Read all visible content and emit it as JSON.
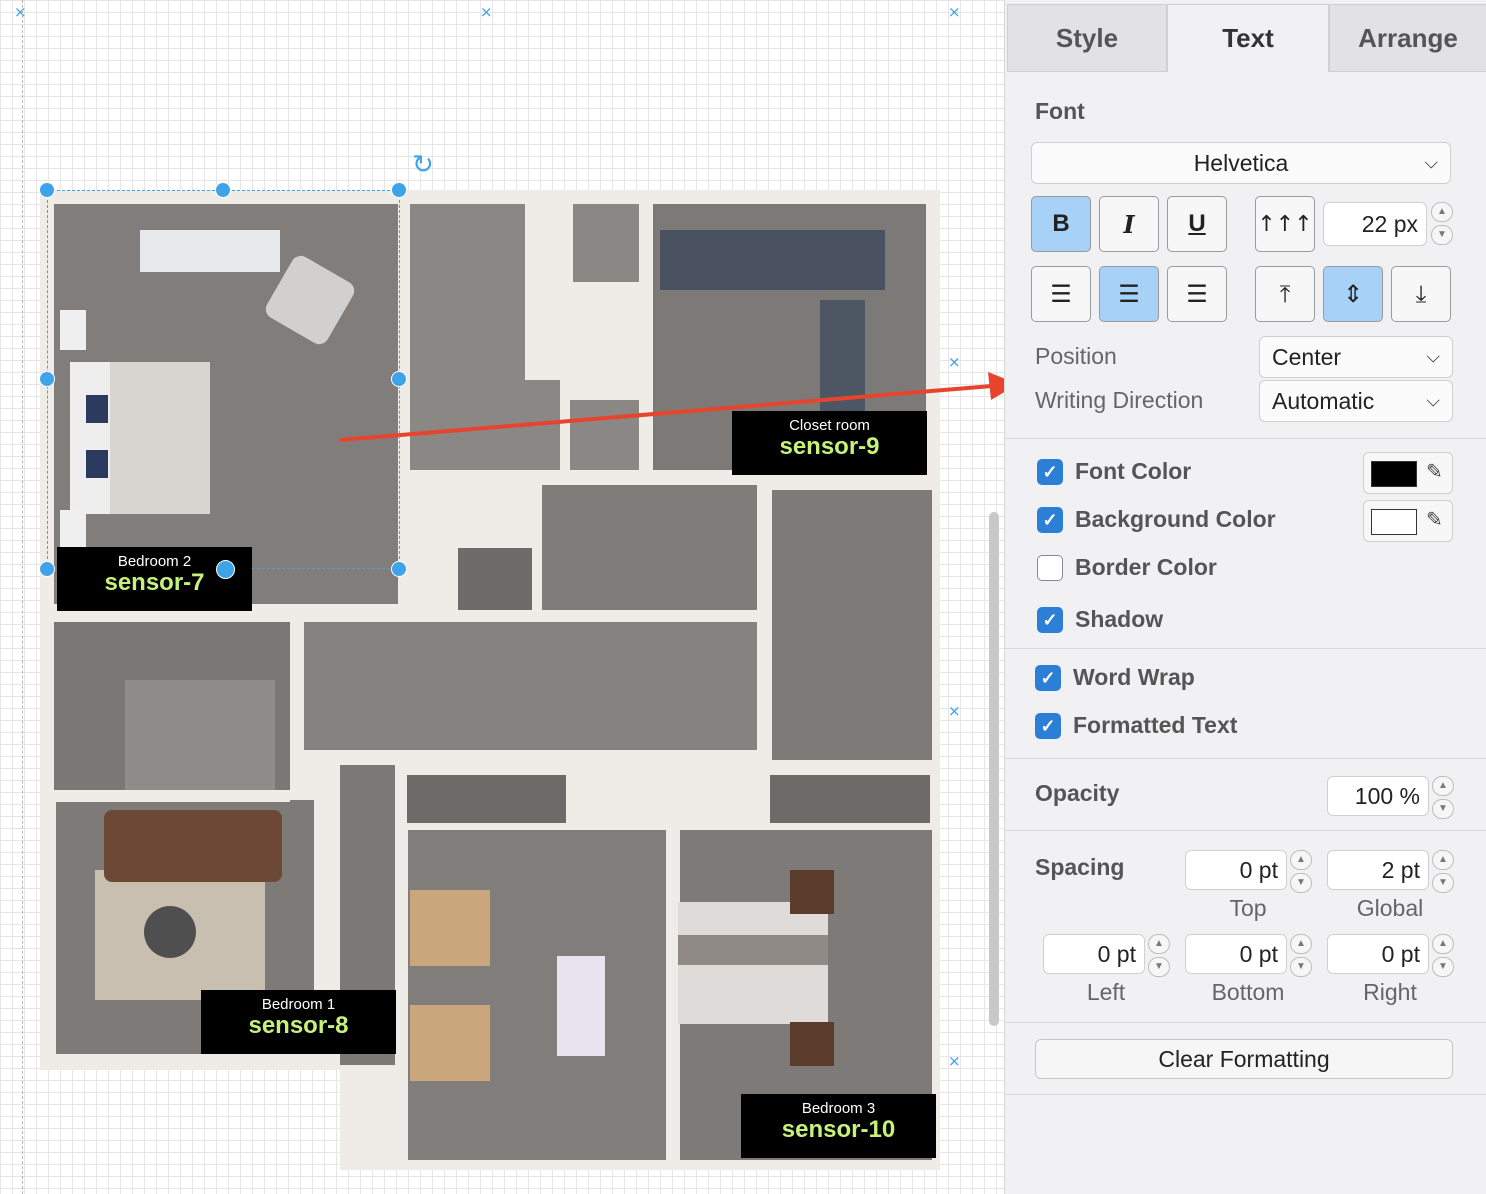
{
  "canvas": {
    "labels": {
      "bedroom2": {
        "room": "Bedroom 2",
        "sensor": "sensor-7"
      },
      "closet": {
        "room": "Closet room",
        "sensor": "sensor-9"
      },
      "bedroom1": {
        "room": "Bedroom 1",
        "sensor": "sensor-8"
      },
      "bedroom3": {
        "room": "Bedroom 3",
        "sensor": "sensor-10"
      }
    },
    "accent_color": "#3fa3ea",
    "arrow_color": "#e8432d",
    "label_text_color": "#c6f27a"
  },
  "panel": {
    "tabs": [
      {
        "label": "Style",
        "active": false
      },
      {
        "label": "Text",
        "active": true
      },
      {
        "label": "Arrange",
        "active": false
      }
    ],
    "font": {
      "section_title": "Font",
      "family": "Helvetica",
      "size": "22 px",
      "bold_label": "B",
      "italic_label": "I",
      "underline_label": "U"
    },
    "position": {
      "label": "Position",
      "value": "Center"
    },
    "writing_direction": {
      "label": "Writing Direction",
      "value": "Automatic"
    },
    "checks": {
      "font_color": {
        "label": "Font Color",
        "checked": true,
        "color": "#000000"
      },
      "background_color": {
        "label": "Background Color",
        "checked": true,
        "color": "#ffffff"
      },
      "border_color": {
        "label": "Border Color",
        "checked": false
      },
      "shadow": {
        "label": "Shadow",
        "checked": true
      },
      "word_wrap": {
        "label": "Word Wrap",
        "checked": true
      },
      "formatted_text": {
        "label": "Formatted Text",
        "checked": true
      }
    },
    "opacity": {
      "label": "Opacity",
      "value": "100 %"
    },
    "spacing": {
      "label": "Spacing",
      "top": {
        "label": "Top",
        "value": "0 pt"
      },
      "global": {
        "label": "Global",
        "value": "2 pt"
      },
      "left": {
        "label": "Left",
        "value": "0 pt"
      },
      "bottom": {
        "label": "Bottom",
        "value": "0 pt"
      },
      "right": {
        "label": "Right",
        "value": "0 pt"
      }
    },
    "clear_formatting": "Clear Formatting"
  }
}
